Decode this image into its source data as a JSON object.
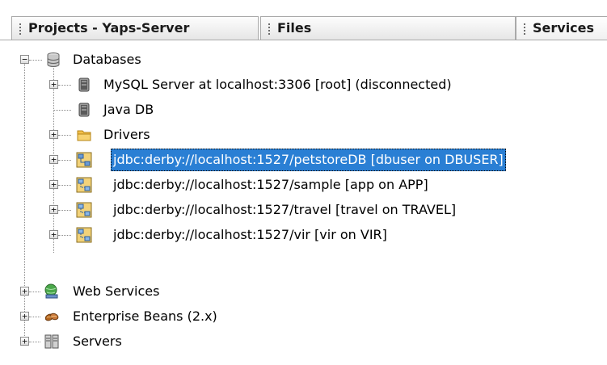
{
  "tabs": [
    {
      "label": "Projects - Yaps-Server",
      "active": false
    },
    {
      "label": "Files",
      "active": false
    },
    {
      "label": "Services",
      "active": true
    }
  ],
  "tree": {
    "databases": {
      "label": "Databases",
      "expanded": true,
      "children": [
        {
          "label": "MySQL Server at localhost:3306 [root] (disconnected)",
          "icon": "database-server-icon"
        },
        {
          "label": "Java DB",
          "icon": "database-server-icon"
        },
        {
          "label": "Drivers",
          "icon": "folder-icon"
        },
        {
          "label": "jdbc:derby://localhost:1527/petstoreDB [dbuser on DBUSER]",
          "icon": "db-connection-icon",
          "selected": true
        },
        {
          "label": "jdbc:derby://localhost:1527/sample [app on APP]",
          "icon": "db-connection-icon"
        },
        {
          "label": "jdbc:derby://localhost:1527/travel [travel on TRAVEL]",
          "icon": "db-connection-icon"
        },
        {
          "label": "jdbc:derby://localhost:1527/vir [vir on VIR]",
          "icon": "db-connection-icon"
        }
      ]
    },
    "web_services": {
      "label": "Web Services",
      "icon": "web-services-globe-icon"
    },
    "enterprise_beans": {
      "label": "Enterprise Beans (2.x)",
      "icon": "enterprise-beans-icon"
    },
    "servers": {
      "label": "Servers",
      "icon": "servers-icon"
    }
  },
  "colors": {
    "selection": "#2a7fd4",
    "tab_border": "#a9a9a9"
  }
}
